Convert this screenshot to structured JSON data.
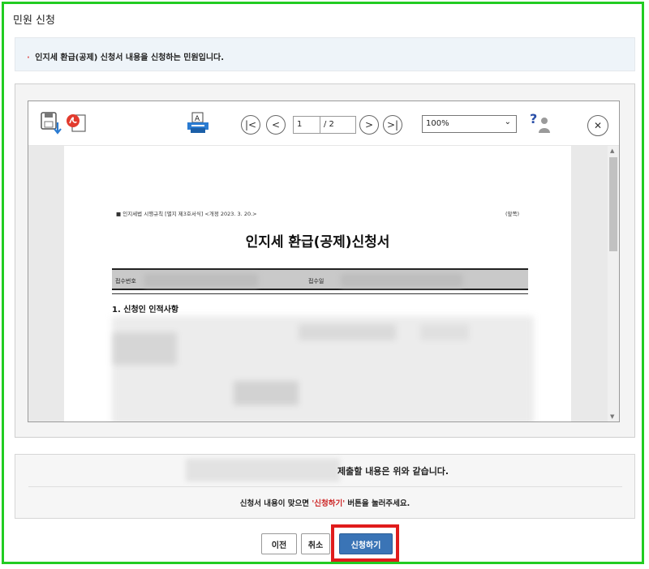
{
  "page": {
    "title": "민원 신청"
  },
  "notice": {
    "bullet": "·",
    "text": "인지세 환급(공제) 신청서 내용을 신청하는 민원입니다."
  },
  "viewer": {
    "toolbar": {
      "page_current": "1",
      "page_total": "/ 2",
      "zoom": "100%",
      "first_glyph": "|<",
      "prev_glyph": "<",
      "next_glyph": ">",
      "last_glyph": ">|",
      "close_glyph": "✕",
      "help_glyph": "?"
    },
    "document": {
      "form_header": "■ 인지세법 시행규칙 [별지 제3호서식] <개정 2023. 3. 20.>",
      "form_attach": "(앞쪽)",
      "form_title": "인지세 환급(공제)신청서",
      "receipt_no_label": "접수번호",
      "receipt_date_label": "접수일",
      "section1_title": "1.  신청인 인적사항"
    }
  },
  "confirm": {
    "statement": "제출할 내용은 위와 같습니다.",
    "guide_prefix": "신청서 내용이 맞으면 ",
    "guide_highlight": "'신청하기'",
    "guide_suffix": " 버튼을 눌러주세요."
  },
  "buttons": {
    "prev": "이전",
    "cancel": "취소",
    "apply": "신청하기"
  },
  "colors": {
    "frame": "#22cc22",
    "apply_highlight": "#e01c1c",
    "apply_button": "#3a74b6"
  }
}
